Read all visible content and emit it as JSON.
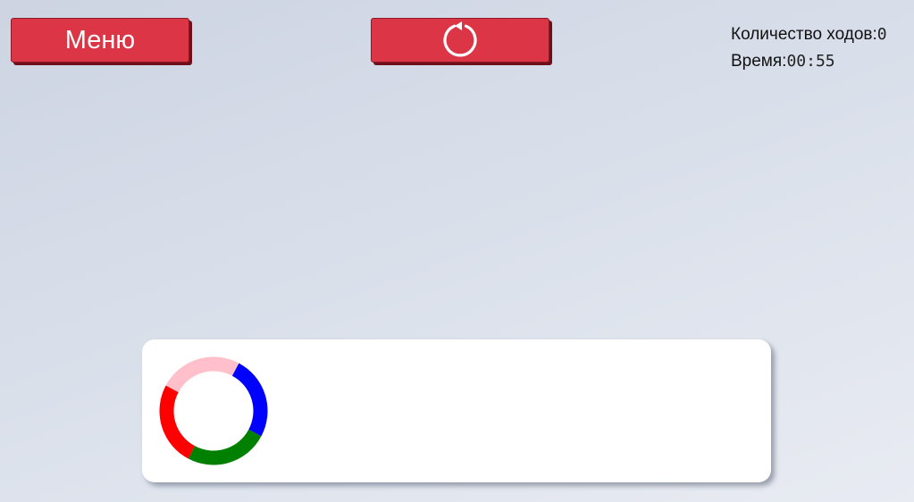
{
  "toolbar": {
    "menu_label": "Меню",
    "restart_icon": "restart-icon"
  },
  "stats": {
    "moves_label": "Количество ходов:",
    "moves_value": "0",
    "time_label": "Время:",
    "time_value": "00:55"
  },
  "colors": {
    "button": "#dc3545",
    "ring_segments": [
      "#ffc0cb",
      "#0000ff",
      "#008000",
      "#ff0000"
    ]
  },
  "panel": {
    "pieces": [
      {
        "type": "ring",
        "segments": [
          "pink",
          "blue",
          "green",
          "red"
        ]
      }
    ]
  }
}
